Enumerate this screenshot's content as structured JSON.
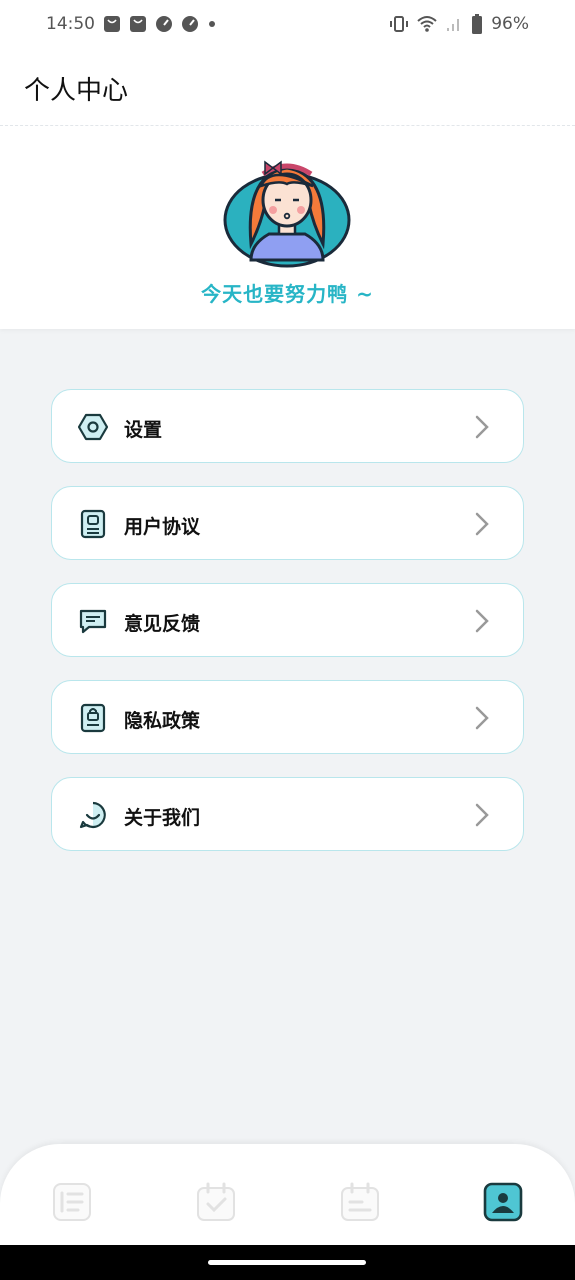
{
  "status_bar": {
    "time": "14:50",
    "battery": "96%",
    "icons": [
      "bag-icon",
      "bag-icon",
      "speedometer-icon",
      "speedometer-icon",
      "dot-icon",
      "vibrate-icon",
      "wifi-icon",
      "signal-icon",
      "battery-icon"
    ]
  },
  "header": {
    "title": "个人中心"
  },
  "profile": {
    "slogan": "今天也要努力鸭 ~"
  },
  "menu": {
    "items": [
      {
        "label": "设置",
        "icon": "settings-hexagon-icon"
      },
      {
        "label": "用户协议",
        "icon": "user-agreement-icon"
      },
      {
        "label": "意见反馈",
        "icon": "feedback-message-icon"
      },
      {
        "label": "隐私政策",
        "icon": "privacy-lock-icon"
      },
      {
        "label": "关于我们",
        "icon": "about-smile-chat-icon"
      }
    ]
  },
  "tabbar": {
    "tabs": [
      {
        "icon": "list-icon",
        "active": false
      },
      {
        "icon": "check-calendar-icon",
        "active": false
      },
      {
        "icon": "notes-icon",
        "active": false
      },
      {
        "icon": "profile-icon",
        "active": true
      }
    ]
  },
  "colors": {
    "accent": "#27b5c6",
    "border": "#b9e6ec",
    "dark_icon": "#1a3a3e",
    "inactive_icon": "#dddddd"
  }
}
